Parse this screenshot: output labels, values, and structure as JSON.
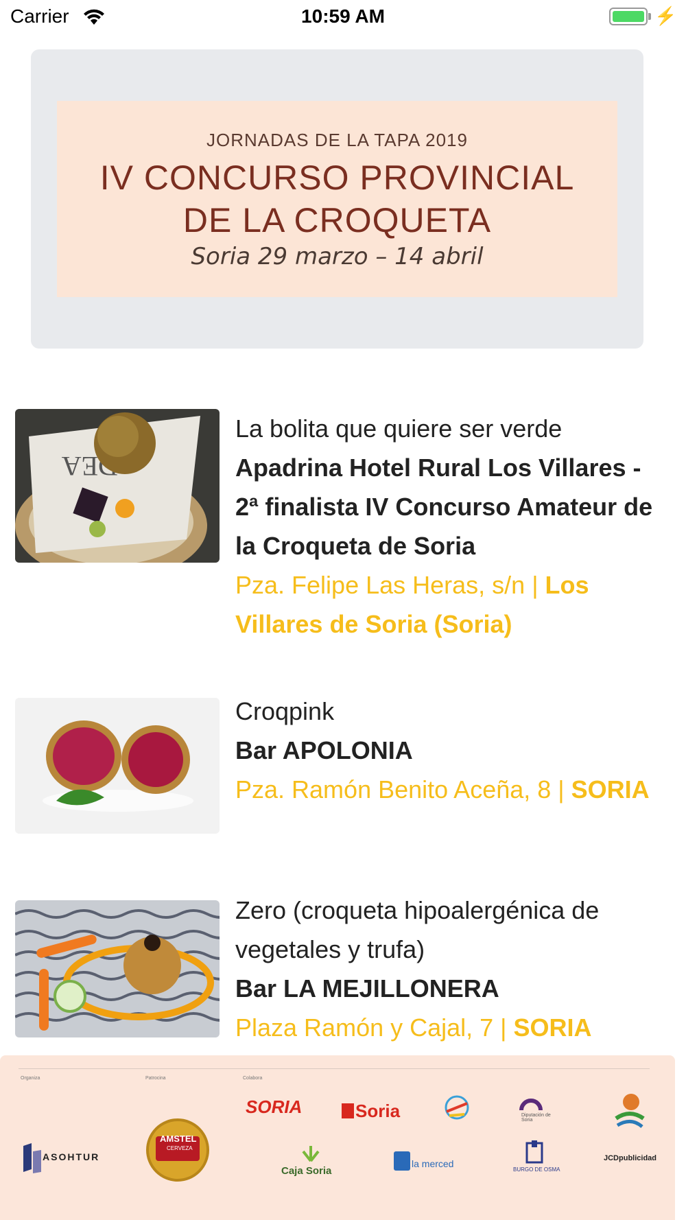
{
  "status_bar": {
    "carrier": "Carrier",
    "time": "10:59 AM"
  },
  "banner": {
    "line1": "JORNADAS DE LA TAPA 2019",
    "line2a": "IV CONCURSO PROVINCIAL",
    "line2b": "DE LA CROQUETA",
    "line3": "Soria 29 marzo – 14 abril"
  },
  "items": [
    {
      "tapa": "La bolita que quiere ser verde",
      "sponsor": "Apadrina Hotel Rural Los Villares - 2ª finalista IV Concurso Amateur de la Croqueta de Soria",
      "address": "Pza. Felipe Las Heras, s/n | ",
      "city": "Los Villares de Soria (Soria)"
    },
    {
      "tapa": "Croqpink",
      "sponsor": "Bar APOLONIA",
      "address": "Pza. Ramón Benito Aceña, 8 | ",
      "city": "SORIA"
    },
    {
      "tapa": "Zero (croqueta hipoalergénica de vegetales y trufa)",
      "sponsor": "Bar LA MEJILLONERA",
      "address": "Plaza Ramón y Cajal, 7 | ",
      "city": "SORIA"
    }
  ],
  "footer": {
    "caption_organiza": "Organiza",
    "caption_patrocina": "Patrocina",
    "caption_colabora": "Colabora",
    "logos": {
      "asohtur": "ASOHTUR",
      "amstel": "AMSTEL",
      "amstel_sub": "CERVEZA",
      "soria_tourism": "SORIA",
      "soria_city": "Soria",
      "caja_soria": "Caja Soria",
      "la_merced": "la merced",
      "diputacion": "Diputación de Soria",
      "burgo_osma": "BURGO DE OSMA",
      "jcd": "JCDpublicidad"
    }
  }
}
